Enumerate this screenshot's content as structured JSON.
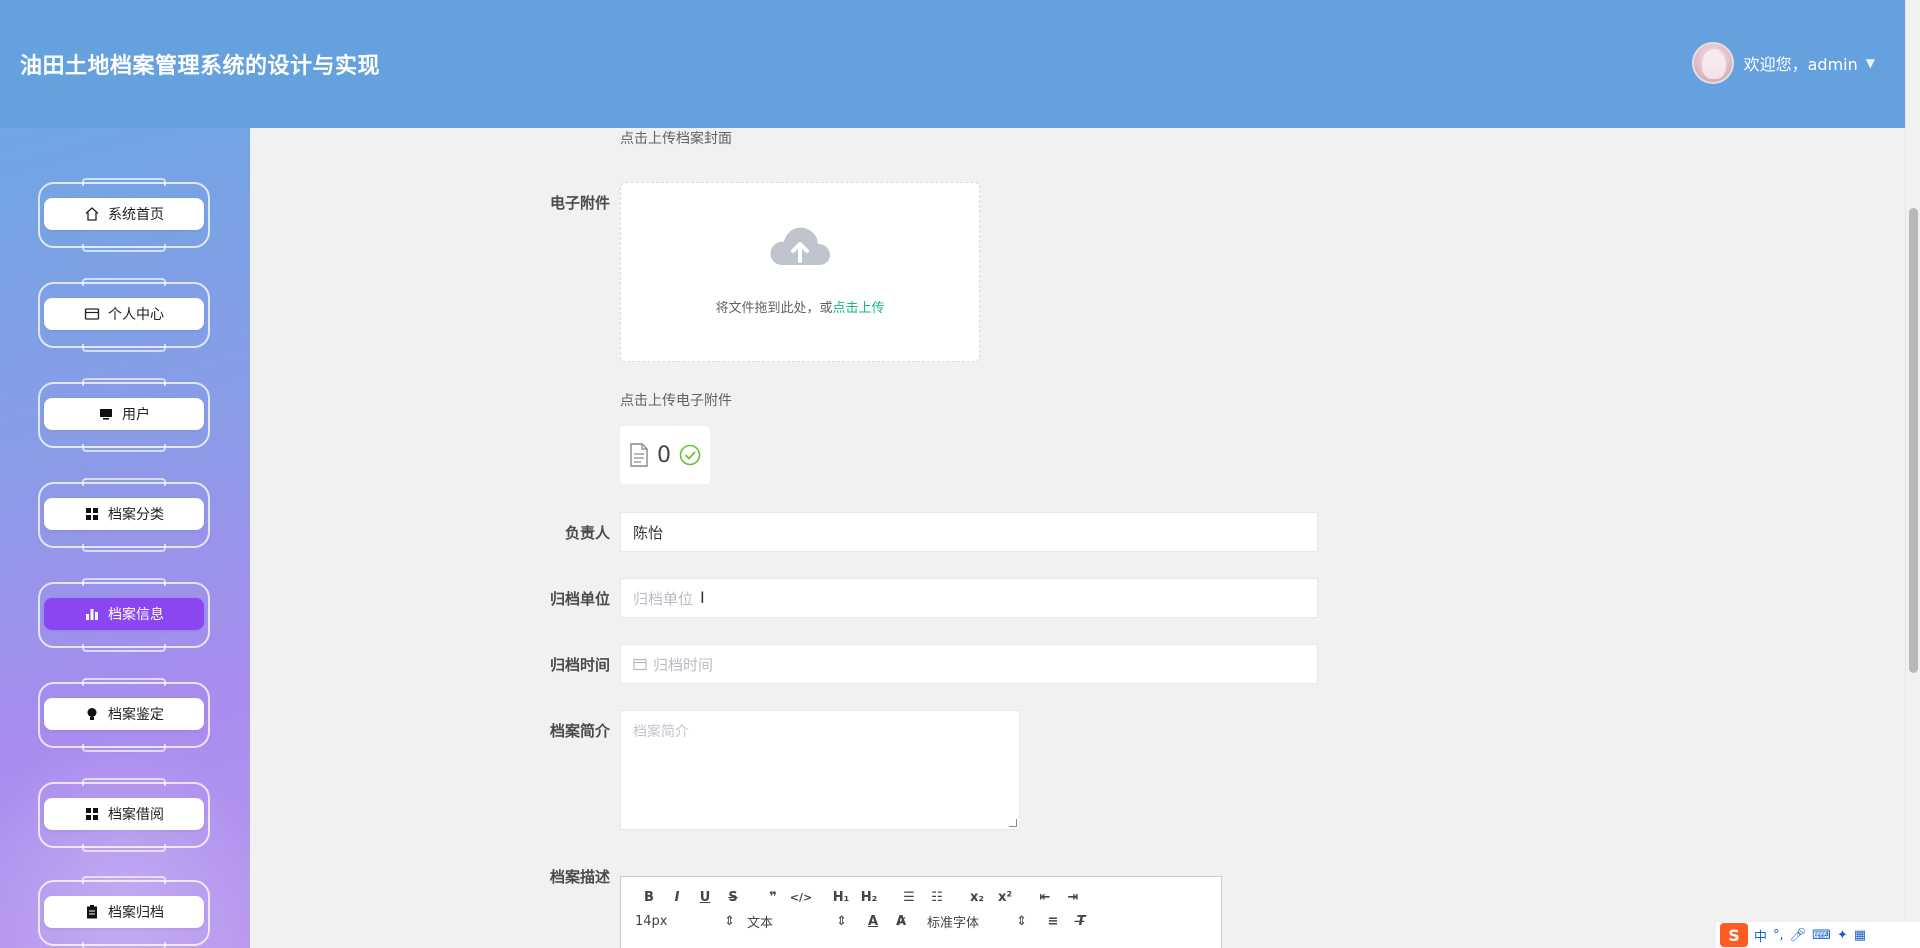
{
  "header": {
    "title": "油田土地档案管理系统的设计与实现",
    "welcome": "欢迎您，admin",
    "caret": "▼"
  },
  "sidebar": {
    "items": [
      {
        "label": "系统首页",
        "icon": "home-icon"
      },
      {
        "label": "个人中心",
        "icon": "id-card-icon"
      },
      {
        "label": "用户",
        "icon": "monitor-icon"
      },
      {
        "label": "档案分类",
        "icon": "grid-icon"
      },
      {
        "label": "档案信息",
        "icon": "bar-chart-icon",
        "active": true
      },
      {
        "label": "档案鉴定",
        "icon": "bulb-icon"
      },
      {
        "label": "档案借阅",
        "icon": "grid-icon"
      },
      {
        "label": "档案归档",
        "icon": "clipboard-icon"
      }
    ]
  },
  "form": {
    "cover_hint": "点击上传档案封面",
    "attachment": {
      "label": "电子附件",
      "upload_text": "将文件拖到此处，或",
      "upload_link": "点击上传",
      "hint": "点击上传电子附件",
      "file_count": "0"
    },
    "owner": {
      "label": "负责人",
      "value": "陈怡"
    },
    "unit": {
      "label": "归档单位",
      "placeholder": "归档单位"
    },
    "time": {
      "label": "归档时间",
      "placeholder": "归档时间"
    },
    "intro": {
      "label": "档案简介",
      "placeholder": "档案简介"
    },
    "description": {
      "label": "档案描述"
    }
  },
  "editor": {
    "size": "14px",
    "format": "文本",
    "font": "标准字体"
  },
  "ime": {
    "lang": "中"
  },
  "colors": {
    "header": "#66a1df",
    "active_menu": "#8b46f1",
    "link": "#13b789"
  }
}
